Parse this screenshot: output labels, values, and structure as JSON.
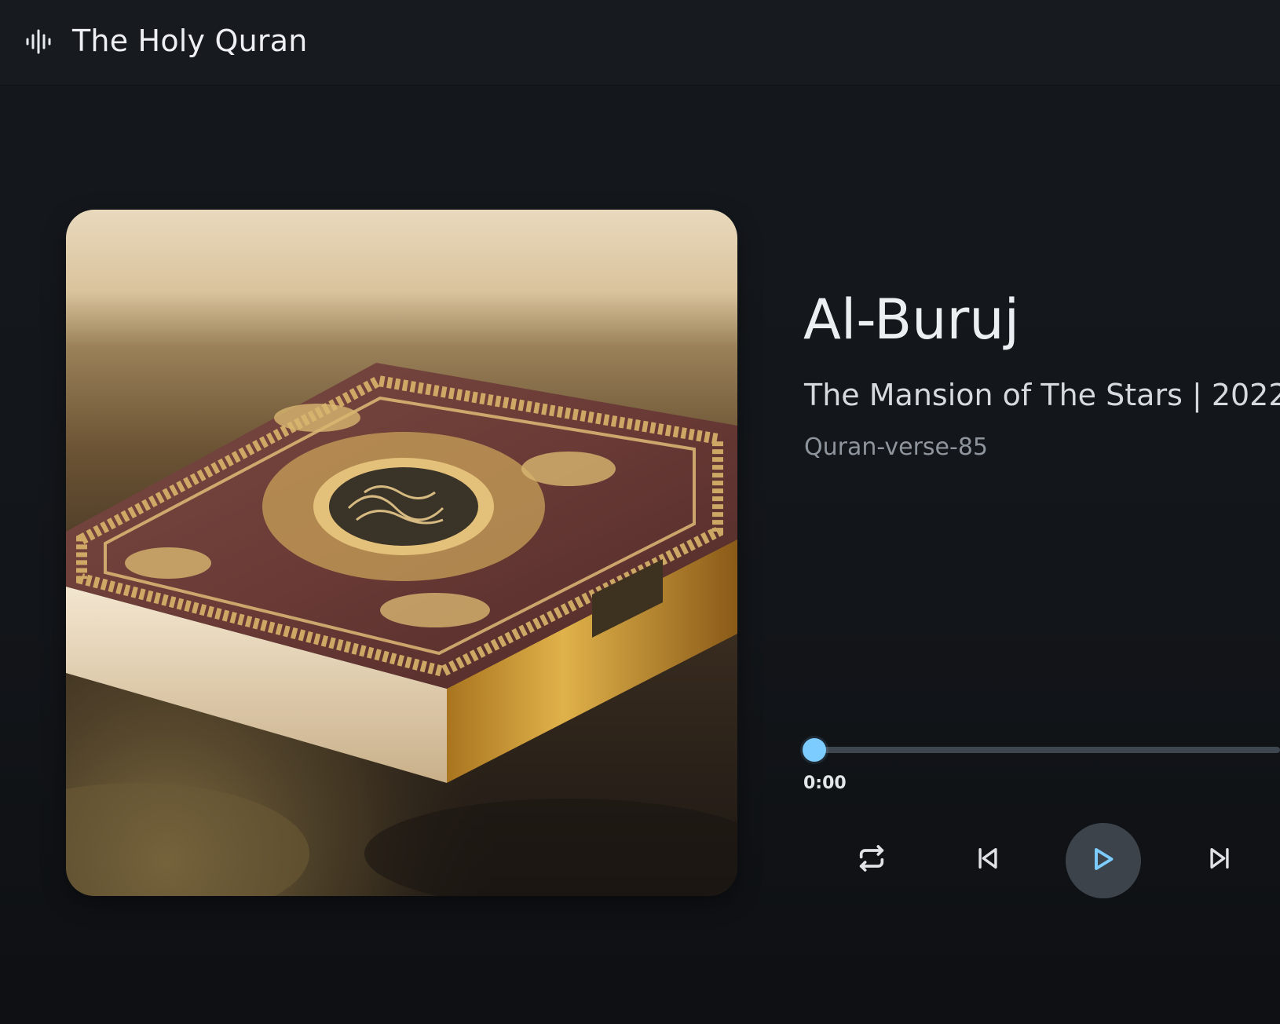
{
  "header": {
    "app_title": "The Holy Quran",
    "logo_icon": "audio-wave-icon"
  },
  "track": {
    "title": "Al-Buruj",
    "subtitle": "The Mansion of The Stars | 2022",
    "identifier": "Quran-verse-85",
    "artwork_description_icon": "quran-book-image"
  },
  "player": {
    "current_time": "0:00",
    "progress_fraction": 0,
    "controls": {
      "repeat": "repeat-icon",
      "previous": "skip-previous-icon",
      "play": "play-icon",
      "next": "skip-next-icon"
    }
  },
  "colors": {
    "accent": "#7dccff",
    "background": "#121418",
    "topbar": "#171b20",
    "play_button_bg": "#3c434b",
    "track_bar": "#3e464f"
  }
}
